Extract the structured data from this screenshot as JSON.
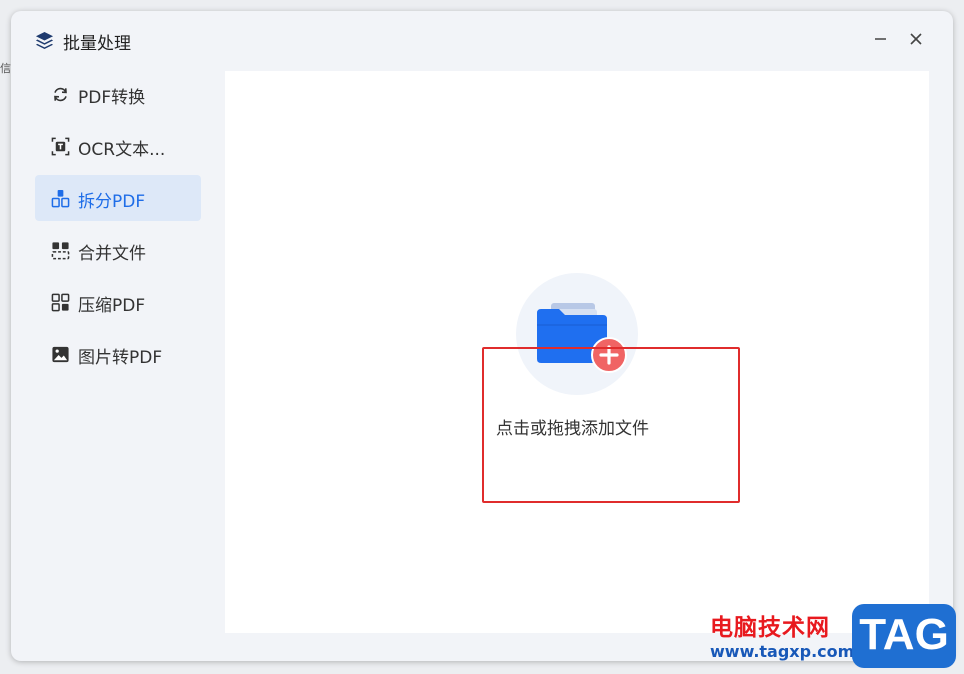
{
  "stray_text": "信",
  "window": {
    "title": "批量处理",
    "minimize_icon": "minimize-icon",
    "close_icon": "close-icon"
  },
  "sidebar": {
    "items": [
      {
        "label": "PDF转换",
        "icon": "convert-icon",
        "active": false
      },
      {
        "label": "OCR文本...",
        "icon": "ocr-text-icon",
        "active": false
      },
      {
        "label": "拆分PDF",
        "icon": "split-icon",
        "active": true
      },
      {
        "label": "合并文件",
        "icon": "merge-icon",
        "active": false
      },
      {
        "label": "压缩PDF",
        "icon": "compress-icon",
        "active": false
      },
      {
        "label": "图片转PDF",
        "icon": "image-to-pdf-icon",
        "active": false
      }
    ]
  },
  "main": {
    "drop_text": "点击或拖拽添加文件",
    "folder_icon": "folder-icon",
    "plus_icon": "plus-icon"
  },
  "watermark": {
    "cn": "电脑技术网",
    "url": "www.tagxp.com",
    "tag": "TAG"
  },
  "colors": {
    "accent": "#1e6de8",
    "active_bg": "#dde8f8",
    "annotation_border": "#e02c2c",
    "folder_blue": "#1f6ff0",
    "plus_red": "#f06464"
  }
}
